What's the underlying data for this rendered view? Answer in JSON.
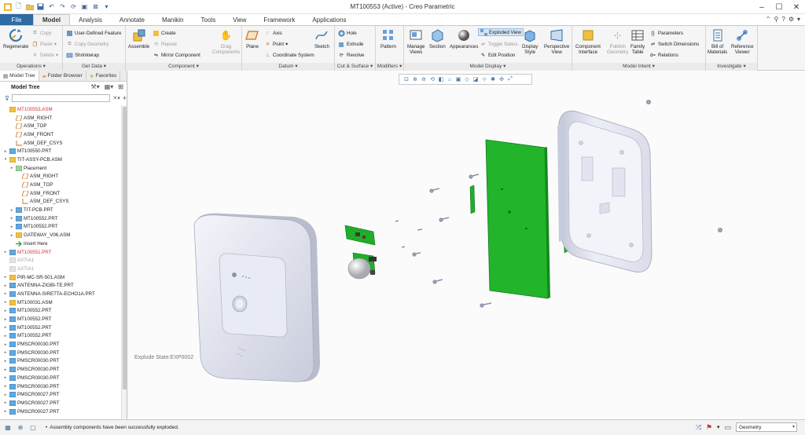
{
  "window": {
    "title": "MT100553 (Active) - Creo Parametric"
  },
  "tabs": [
    {
      "label": "File"
    },
    {
      "label": "Model"
    },
    {
      "label": "Analysis"
    },
    {
      "label": "Annotate"
    },
    {
      "label": "Manikin"
    },
    {
      "label": "Tools"
    },
    {
      "label": "View"
    },
    {
      "label": "Framework"
    },
    {
      "label": "Applications"
    }
  ],
  "ribbon": {
    "operations": {
      "regenerate": "Regenerate",
      "copy": "Copy",
      "paste": "Paste",
      "delete": "Delete",
      "label": "Operations ▾"
    },
    "get_data": {
      "udf": "User-Defined Feature",
      "copy_geometry": "Copy Geometry",
      "shrinkwrap": "Shrinkwrap",
      "label": "Get Data ▾"
    },
    "component": {
      "assemble": "Assemble",
      "create": "Create",
      "repeat": "Repeat",
      "mirror": "Mirror Component",
      "drag": "Drag",
      "drag2": "Components",
      "label": "Component ▾"
    },
    "datum": {
      "plane": "Plane",
      "axis": "Axis",
      "point": "Point",
      "csys": "Coordinate System",
      "sketch": "Sketch",
      "label": "Datum ▾"
    },
    "cut_surface": {
      "hole": "Hole",
      "extrude": "Extrude",
      "revolve": "Revolve",
      "label": "Cut & Surface ▾"
    },
    "modifiers": {
      "pattern": "Pattern",
      "label": "Modifiers ▾"
    },
    "model_display": {
      "manage": "Manage",
      "views": "Views",
      "section": "Section",
      "appearances": "Appearances",
      "exploded": "Exploded View",
      "toggle": "Toggle Status",
      "edit_position": "Edit Position",
      "display": "Display",
      "style": "Style",
      "perspective": "Perspective",
      "view": "View",
      "label": "Model Display ▾"
    },
    "model_intent": {
      "ci1": "Component",
      "ci2": "Interface",
      "pg1": "Publish",
      "pg2": "Geometry",
      "ft1": "Family",
      "ft2": "Table",
      "parameters": "Parameters",
      "switch_dims": "Switch Dimensions",
      "relations": "Relations",
      "label": "Model Intent ▾"
    },
    "investigate": {
      "bom1": "Bill of",
      "bom2": "Materials",
      "rv1": "Reference",
      "rv2": "Viewer",
      "label": "Investigate ▾"
    }
  },
  "panel": {
    "tabs": [
      {
        "label": "Model Tree"
      },
      {
        "label": "Folder Browser"
      },
      {
        "label": "Favorites"
      }
    ],
    "tree_title": "Model Tree"
  },
  "tree": [
    {
      "label": "MT100553.ASM",
      "style": "red",
      "indent": 0,
      "tw": "",
      "icon": "asm"
    },
    {
      "label": "ASM_RIGHT",
      "style": "",
      "indent": 1,
      "tw": "",
      "icon": "plane"
    },
    {
      "label": "ASM_TOP",
      "style": "",
      "indent": 1,
      "tw": "",
      "icon": "plane"
    },
    {
      "label": "ASM_FRONT",
      "style": "",
      "indent": 1,
      "tw": "",
      "icon": "plane"
    },
    {
      "label": "ASM_DEF_CSYS",
      "style": "",
      "indent": 1,
      "tw": "",
      "icon": "csys"
    },
    {
      "label": "MT100550.PRT",
      "style": "",
      "indent": 0,
      "tw": "▸",
      "icon": "prt"
    },
    {
      "label": "TIT-ASSY-PCB.ASM",
      "style": "",
      "indent": 0,
      "tw": "▾",
      "icon": "asm"
    },
    {
      "label": "Placement",
      "style": "",
      "indent": 1,
      "tw": "▸",
      "icon": "place"
    },
    {
      "label": "ASM_RIGHT",
      "style": "",
      "indent": 2,
      "tw": "",
      "icon": "plane"
    },
    {
      "label": "ASM_TOP",
      "style": "",
      "indent": 2,
      "tw": "",
      "icon": "plane"
    },
    {
      "label": "ASM_FRONT",
      "style": "",
      "indent": 2,
      "tw": "",
      "icon": "plane"
    },
    {
      "label": "ASM_DEF_CSYS",
      "style": "",
      "indent": 2,
      "tw": "",
      "icon": "csys"
    },
    {
      "label": "TIT-PCB.PRT",
      "style": "",
      "indent": 1,
      "tw": "▸",
      "icon": "prt"
    },
    {
      "label": "MT100552.PRT",
      "style": "",
      "indent": 1,
      "tw": "▸",
      "icon": "prt"
    },
    {
      "label": "MT100552.PRT",
      "style": "",
      "indent": 1,
      "tw": "▸",
      "icon": "prt"
    },
    {
      "label": "GATEWAY_V06.ASM",
      "style": "",
      "indent": 1,
      "tw": "▸",
      "icon": "asm"
    },
    {
      "label": "Insert Here",
      "style": "",
      "indent": 1,
      "tw": "",
      "icon": "insert"
    },
    {
      "label": "MT100551.PRT",
      "style": "red",
      "indent": 0,
      "tw": "▸",
      "icon": "prt"
    },
    {
      "label": "AXTIA1",
      "style": "gray",
      "indent": 0,
      "tw": "",
      "icon": "gray"
    },
    {
      "label": "AXTIA1",
      "style": "gray",
      "indent": 0,
      "tw": "",
      "icon": "gray"
    },
    {
      "label": "PIR-MC-SR-501.ASM",
      "style": "",
      "indent": 0,
      "tw": "▸",
      "icon": "asm"
    },
    {
      "label": "ANTENNA-ZIGBI-TE.PRT",
      "style": "",
      "indent": 0,
      "tw": "▸",
      "icon": "prt"
    },
    {
      "label": "ANTENNA-SIRETTA-ECHO1A.PRT",
      "style": "",
      "indent": 0,
      "tw": "▸",
      "icon": "prt"
    },
    {
      "label": "MT100031.ASM",
      "style": "",
      "indent": 0,
      "tw": "▸",
      "icon": "asm"
    },
    {
      "label": "MT100552.PRT",
      "style": "",
      "indent": 0,
      "tw": "▸",
      "icon": "prt"
    },
    {
      "label": "MT100552.PRT",
      "style": "",
      "indent": 0,
      "tw": "▸",
      "icon": "prt"
    },
    {
      "label": "MT100552.PRT",
      "style": "",
      "indent": 0,
      "tw": "▸",
      "icon": "prt"
    },
    {
      "label": "MT100552.PRT",
      "style": "",
      "indent": 0,
      "tw": "▸",
      "icon": "prt"
    },
    {
      "label": "PMSCR00030.PRT",
      "style": "",
      "indent": 0,
      "tw": "▸",
      "icon": "prt"
    },
    {
      "label": "PMSCR00030.PRT",
      "style": "",
      "indent": 0,
      "tw": "▸",
      "icon": "prt"
    },
    {
      "label": "PMSCR00030.PRT",
      "style": "",
      "indent": 0,
      "tw": "▸",
      "icon": "prt"
    },
    {
      "label": "PMSCR00030.PRT",
      "style": "",
      "indent": 0,
      "tw": "▸",
      "icon": "prt"
    },
    {
      "label": "PMSCR00030.PRT",
      "style": "",
      "indent": 0,
      "tw": "▸",
      "icon": "prt"
    },
    {
      "label": "PMSCR00030.PRT",
      "style": "",
      "indent": 0,
      "tw": "▸",
      "icon": "prt"
    },
    {
      "label": "PMSCR00027.PRT",
      "style": "",
      "indent": 0,
      "tw": "▸",
      "icon": "prt"
    },
    {
      "label": "PMSCR00027.PRT",
      "style": "",
      "indent": 0,
      "tw": "▸",
      "icon": "prt"
    },
    {
      "label": "PMSCR00027.PRT",
      "style": "",
      "indent": 0,
      "tw": "▸",
      "icon": "prt"
    }
  ],
  "graphics": {
    "explode_state": "Explode State:EXP0002"
  },
  "status": {
    "message": "Assembly components have been successfully exploded.",
    "filter": "Geometry"
  },
  "colors": {
    "accent": "#2e6aa3",
    "pcb_green": "#1fae2a",
    "housing": "#e4e6f2",
    "tree_red": "#d23232"
  }
}
